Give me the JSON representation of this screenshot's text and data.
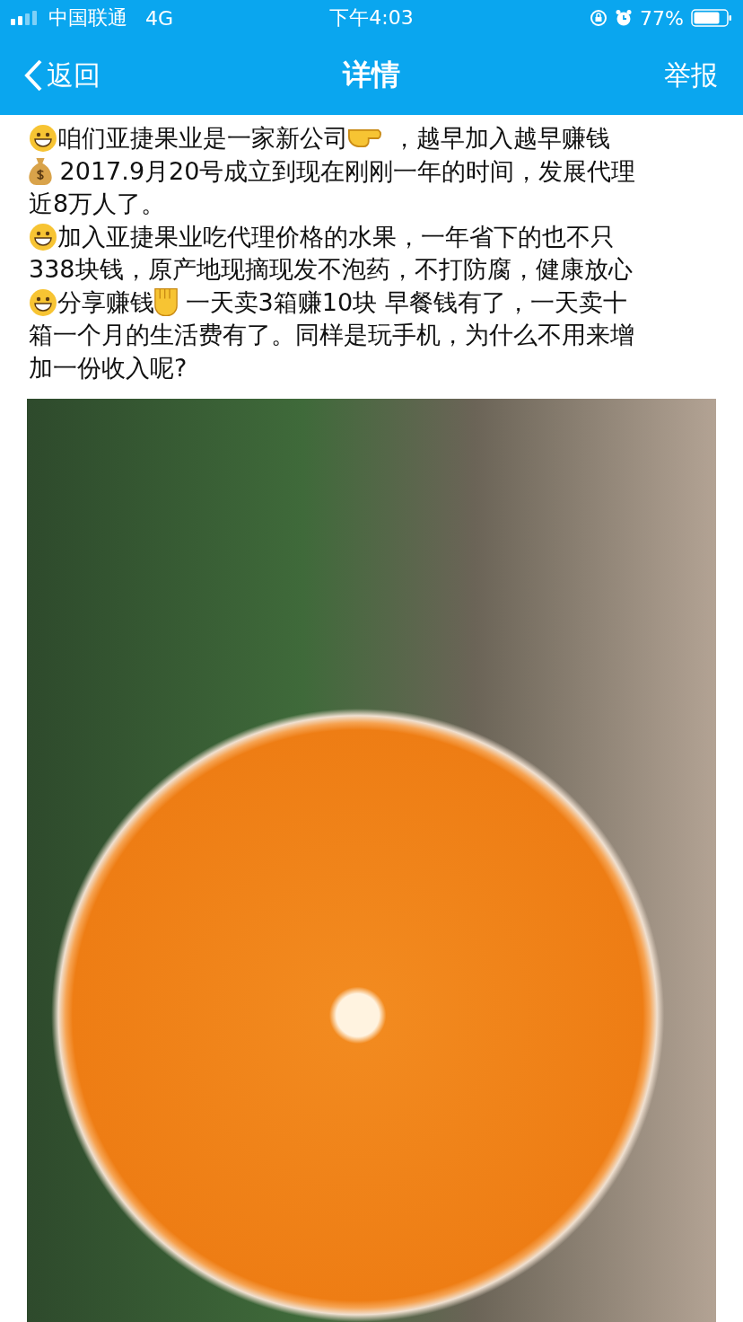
{
  "status_bar": {
    "carrier": "中国联通",
    "network": "4G",
    "time": "下午4:03",
    "battery": "77%"
  },
  "nav": {
    "back": "返回",
    "title": "详情",
    "action": "举报"
  },
  "post": {
    "lines": [
      [
        {
          "kind": "grin"
        },
        {
          "kind": "text",
          "text": "咱们亚捷果业是一家新公司"
        },
        {
          "kind": "pointer"
        },
        {
          "kind": "text",
          "text": " ，越早加入越早赚钱"
        }
      ],
      [
        {
          "kind": "moneybag"
        },
        {
          "kind": "text",
          "text": " 2017.9月20号成立到现在刚刚一年的时间，发展代理"
        }
      ],
      [
        {
          "kind": "text",
          "text": "近8万人了。"
        }
      ],
      [
        {
          "kind": "grin"
        },
        {
          "kind": "text",
          "text": "加入亚捷果业吃代理价格的水果，一年省下的也不只"
        }
      ],
      [
        {
          "kind": "text",
          "text": "338块钱，原产地现摘现发不泡药，不打防腐，健康放心"
        }
      ],
      [
        {
          "kind": "grin"
        },
        {
          "kind": "text",
          "text": "分享赚钱"
        },
        {
          "kind": "fist"
        },
        {
          "kind": "text",
          "text": " 一天卖3箱赚10块 早餐钱有了，一天卖十"
        }
      ],
      [
        {
          "kind": "text",
          "text": "箱一个月的生活费有了。同样是玩手机，为什么不用来增"
        }
      ],
      [
        {
          "kind": "text",
          "text": "加一份收入呢?"
        }
      ]
    ]
  }
}
